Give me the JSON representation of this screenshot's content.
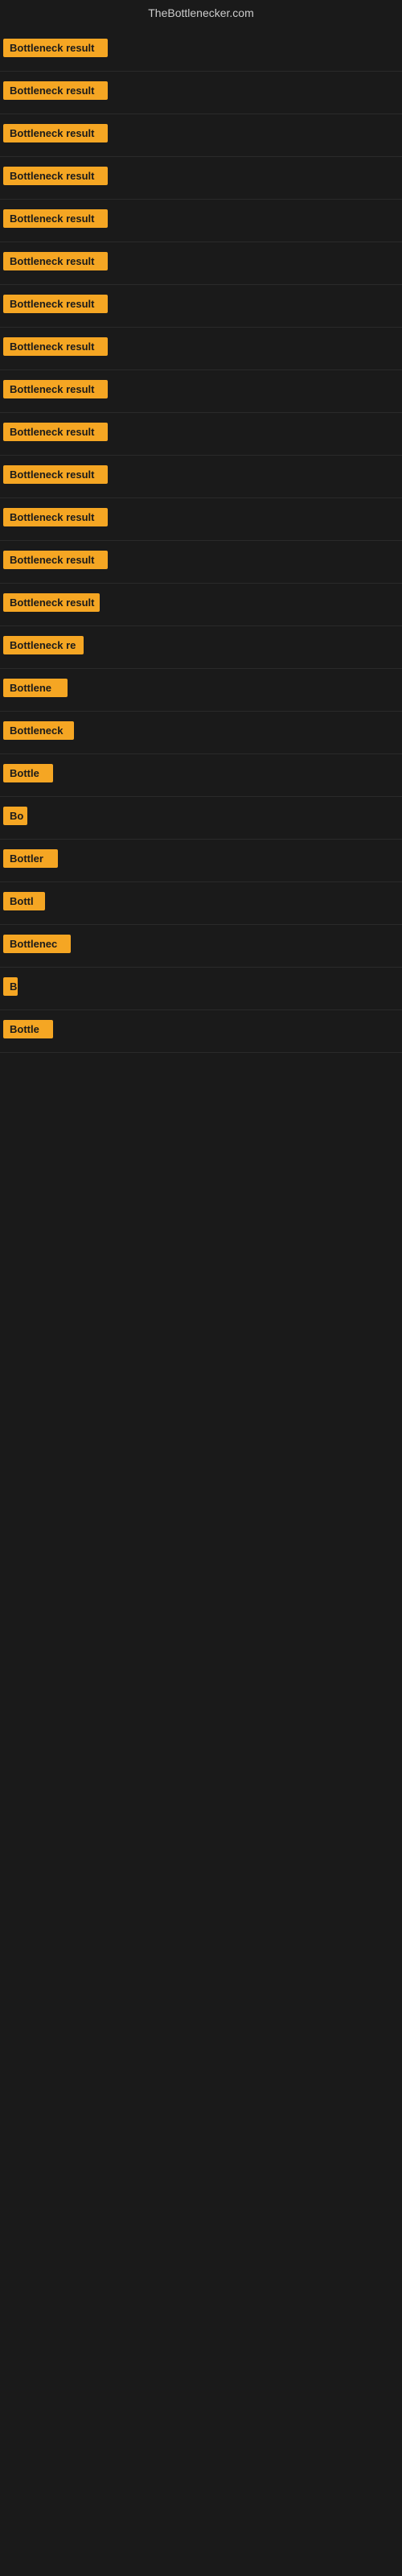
{
  "site": {
    "title": "TheBottlenecker.com"
  },
  "results": [
    {
      "id": 1,
      "label": "Bottleneck result",
      "width": 130
    },
    {
      "id": 2,
      "label": "Bottleneck result",
      "width": 130
    },
    {
      "id": 3,
      "label": "Bottleneck result",
      "width": 130
    },
    {
      "id": 4,
      "label": "Bottleneck result",
      "width": 130
    },
    {
      "id": 5,
      "label": "Bottleneck result",
      "width": 130
    },
    {
      "id": 6,
      "label": "Bottleneck result",
      "width": 130
    },
    {
      "id": 7,
      "label": "Bottleneck result",
      "width": 130
    },
    {
      "id": 8,
      "label": "Bottleneck result",
      "width": 130
    },
    {
      "id": 9,
      "label": "Bottleneck result",
      "width": 130
    },
    {
      "id": 10,
      "label": "Bottleneck result",
      "width": 130
    },
    {
      "id": 11,
      "label": "Bottleneck result",
      "width": 130
    },
    {
      "id": 12,
      "label": "Bottleneck result",
      "width": 130
    },
    {
      "id": 13,
      "label": "Bottleneck result",
      "width": 130
    },
    {
      "id": 14,
      "label": "Bottleneck result",
      "width": 120
    },
    {
      "id": 15,
      "label": "Bottleneck re",
      "width": 100
    },
    {
      "id": 16,
      "label": "Bottlene",
      "width": 80
    },
    {
      "id": 17,
      "label": "Bottleneck",
      "width": 88
    },
    {
      "id": 18,
      "label": "Bottle",
      "width": 62
    },
    {
      "id": 19,
      "label": "Bo",
      "width": 30
    },
    {
      "id": 20,
      "label": "Bottler",
      "width": 68
    },
    {
      "id": 21,
      "label": "Bottl",
      "width": 52
    },
    {
      "id": 22,
      "label": "Bottlenec",
      "width": 84
    },
    {
      "id": 23,
      "label": "B",
      "width": 18
    },
    {
      "id": 24,
      "label": "Bottle",
      "width": 62
    }
  ]
}
